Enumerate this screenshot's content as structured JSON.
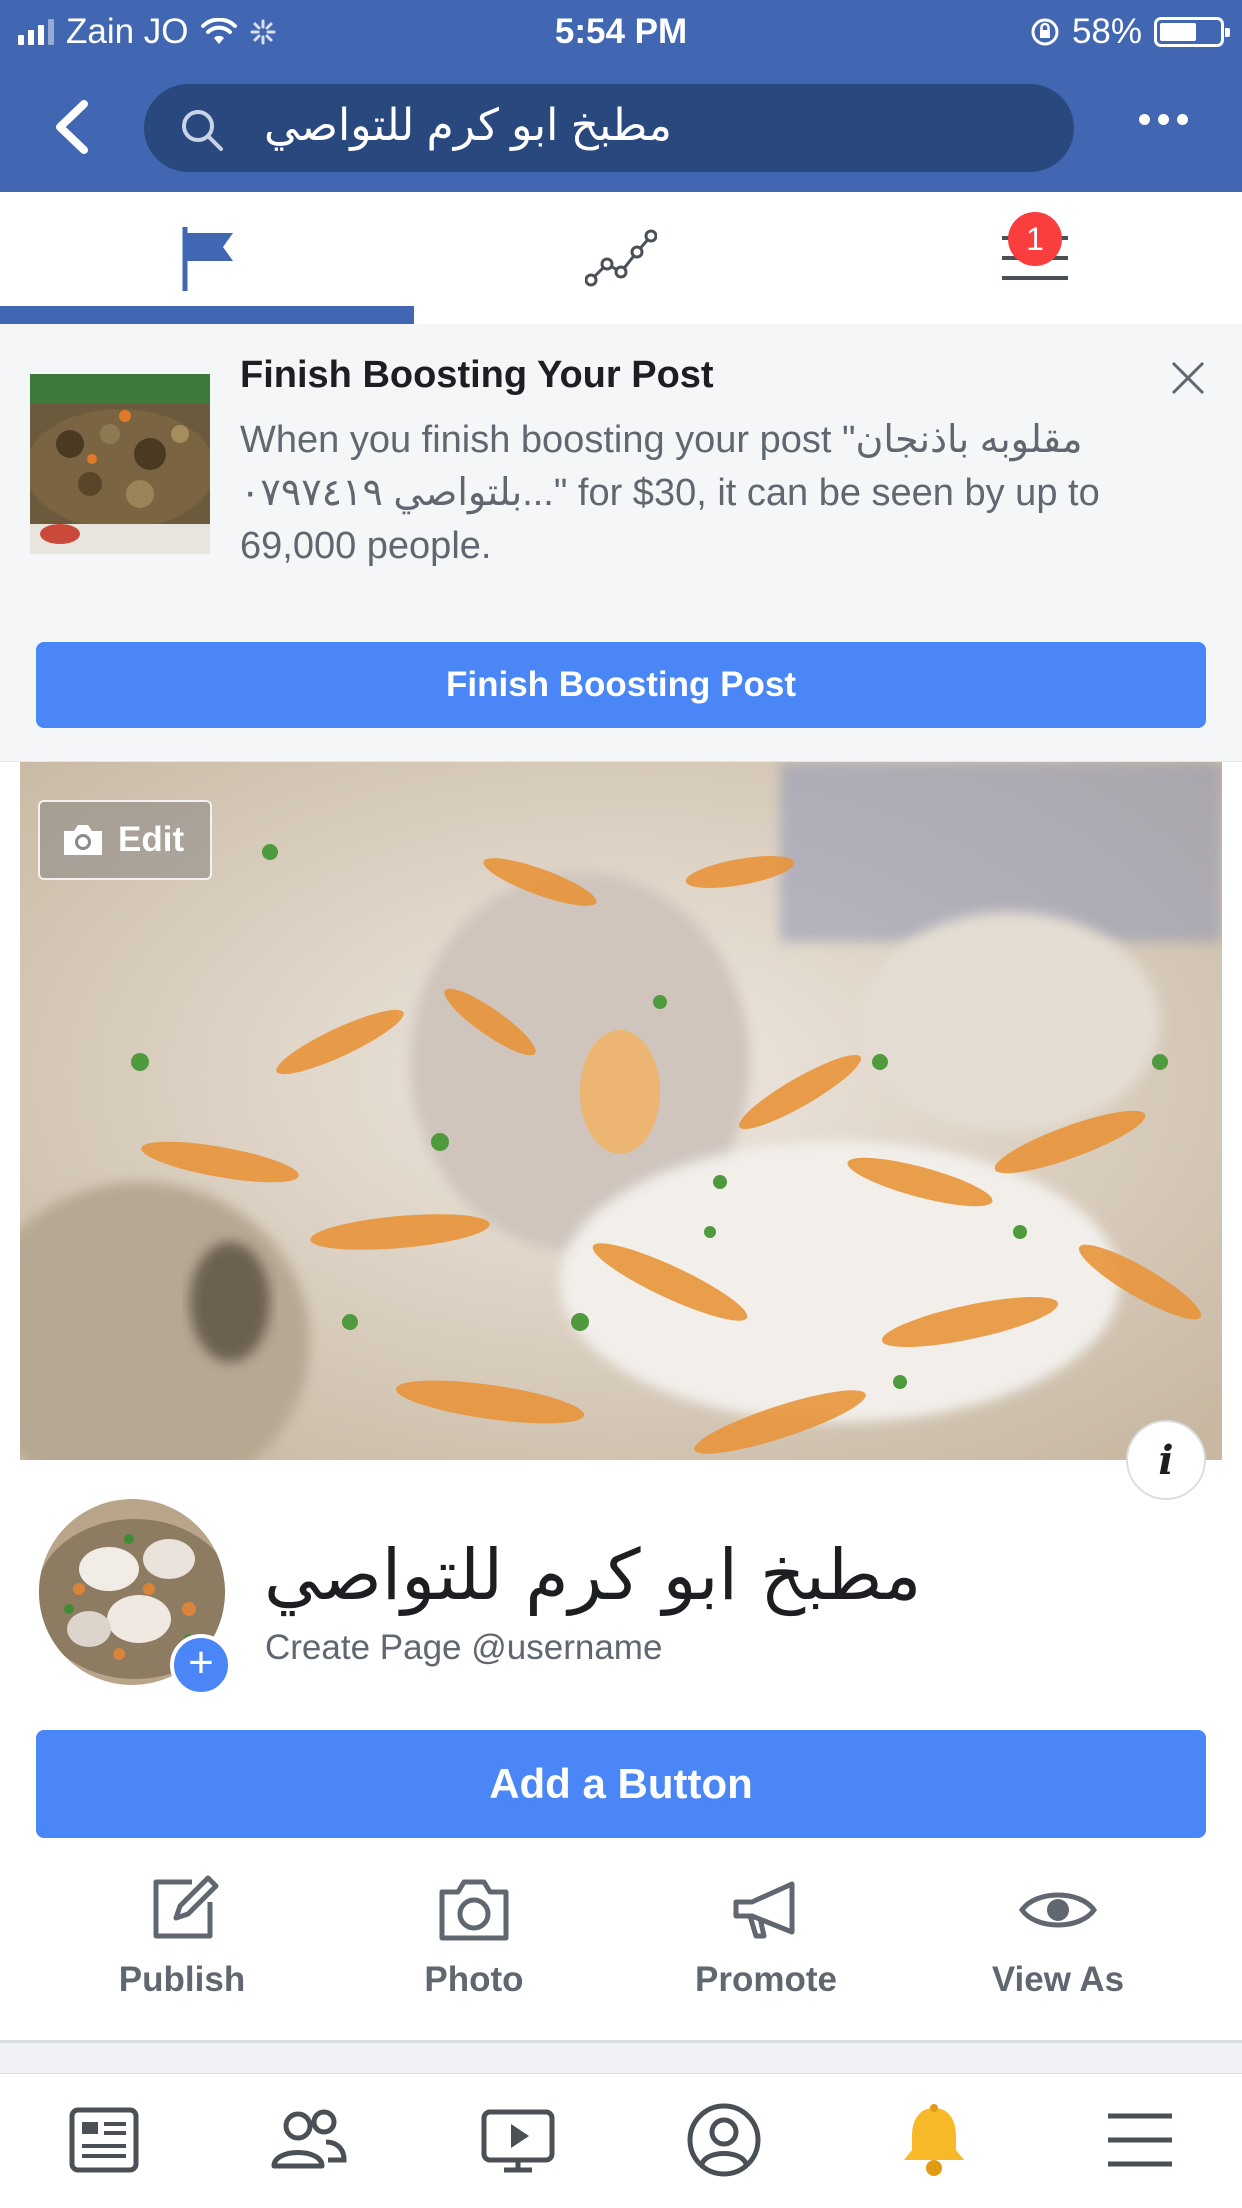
{
  "status_bar": {
    "carrier": "Zain JO",
    "time": "5:54 PM",
    "battery_percent": "58%",
    "battery_level": 0.58
  },
  "nav": {
    "search_text": "مطبخ ابو كرم للتواصي",
    "back_icon": "chevron-left-icon",
    "more_icon": "more-dots-icon"
  },
  "tabs": [
    {
      "name": "page",
      "icon": "flag-icon",
      "active": true
    },
    {
      "name": "insights",
      "icon": "insights-graph-icon",
      "active": false
    },
    {
      "name": "menu",
      "icon": "hamburger-icon",
      "active": false,
      "badge": "1"
    }
  ],
  "boost": {
    "title": "Finish Boosting Your Post",
    "body": "When you finish boosting your post \"مقلوبه باذنجان بلتواصي ٠٧٩٧٤١٩...\" for $30, it can be seen by up to 69,000 people.",
    "button": "Finish Boosting Post"
  },
  "cover": {
    "edit_label": "Edit"
  },
  "profile": {
    "page_name": "مطبخ ابو كرم للتواصي",
    "username_prompt": "Create Page @username"
  },
  "add_button": "Add a Button",
  "actions": [
    {
      "label": "Publish",
      "icon": "edit-icon"
    },
    {
      "label": "Photo",
      "icon": "camera-icon"
    },
    {
      "label": "Promote",
      "icon": "megaphone-icon"
    },
    {
      "label": "View As",
      "icon": "eye-icon"
    }
  ],
  "bottom_tabs": [
    {
      "name": "news-feed",
      "icon": "news-feed-icon"
    },
    {
      "name": "friends",
      "icon": "friends-icon"
    },
    {
      "name": "watch",
      "icon": "watch-icon"
    },
    {
      "name": "profile",
      "icon": "profile-icon"
    },
    {
      "name": "notifications",
      "icon": "bell-icon"
    },
    {
      "name": "menu",
      "icon": "menu-icon"
    }
  ],
  "colors": {
    "brand_blue": "#4267b2",
    "button_blue": "#4a86f5",
    "badge_red": "#fa3e3e",
    "bell_yellow": "#f7b928"
  }
}
